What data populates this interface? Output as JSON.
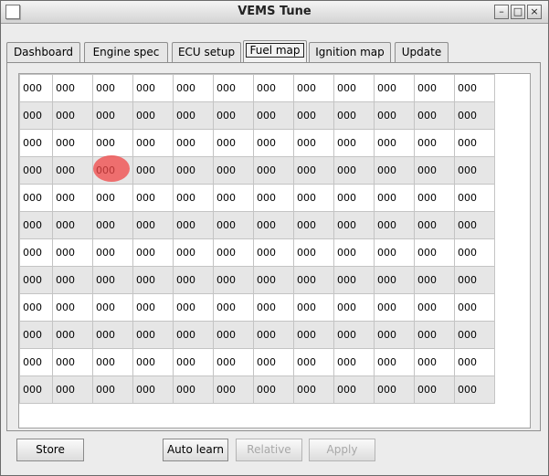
{
  "window": {
    "title": "VEMS Tune",
    "controls": {
      "minimize": "–",
      "maximize": "□",
      "close": "×"
    }
  },
  "tabs": [
    {
      "label": "Dashboard",
      "active": false
    },
    {
      "label": "Engine spec",
      "active": false
    },
    {
      "label": "ECU setup",
      "active": false
    },
    {
      "label": "Fuel map",
      "active": true
    },
    {
      "label": "Ignition map",
      "active": false
    },
    {
      "label": "Update",
      "active": false
    }
  ],
  "fuel_map": {
    "rows": [
      [
        "000",
        "000",
        "000",
        "000",
        "000",
        "000",
        "000",
        "000",
        "000",
        "000",
        "000",
        "000"
      ],
      [
        "000",
        "000",
        "000",
        "000",
        "000",
        "000",
        "000",
        "000",
        "000",
        "000",
        "000",
        "000"
      ],
      [
        "000",
        "000",
        "000",
        "000",
        "000",
        "000",
        "000",
        "000",
        "000",
        "000",
        "000",
        "000"
      ],
      [
        "000",
        "000",
        "000",
        "000",
        "000",
        "000",
        "000",
        "000",
        "000",
        "000",
        "000",
        "000"
      ],
      [
        "000",
        "000",
        "000",
        "000",
        "000",
        "000",
        "000",
        "000",
        "000",
        "000",
        "000",
        "000"
      ],
      [
        "000",
        "000",
        "000",
        "000",
        "000",
        "000",
        "000",
        "000",
        "000",
        "000",
        "000",
        "000"
      ],
      [
        "000",
        "000",
        "000",
        "000",
        "000",
        "000",
        "000",
        "000",
        "000",
        "000",
        "000",
        "000"
      ],
      [
        "000",
        "000",
        "000",
        "000",
        "000",
        "000",
        "000",
        "000",
        "000",
        "000",
        "000",
        "000"
      ],
      [
        "000",
        "000",
        "000",
        "000",
        "000",
        "000",
        "000",
        "000",
        "000",
        "000",
        "000",
        "000"
      ],
      [
        "000",
        "000",
        "000",
        "000",
        "000",
        "000",
        "000",
        "000",
        "000",
        "000",
        "000",
        "000"
      ],
      [
        "000",
        "000",
        "000",
        "000",
        "000",
        "000",
        "000",
        "000",
        "000",
        "000",
        "000",
        "000"
      ],
      [
        "000",
        "000",
        "000",
        "000",
        "000",
        "000",
        "000",
        "000",
        "000",
        "000",
        "000",
        "000"
      ]
    ]
  },
  "buttons": {
    "store": "Store",
    "auto_learn": "Auto learn",
    "relative": "Relative",
    "apply": "Apply"
  }
}
